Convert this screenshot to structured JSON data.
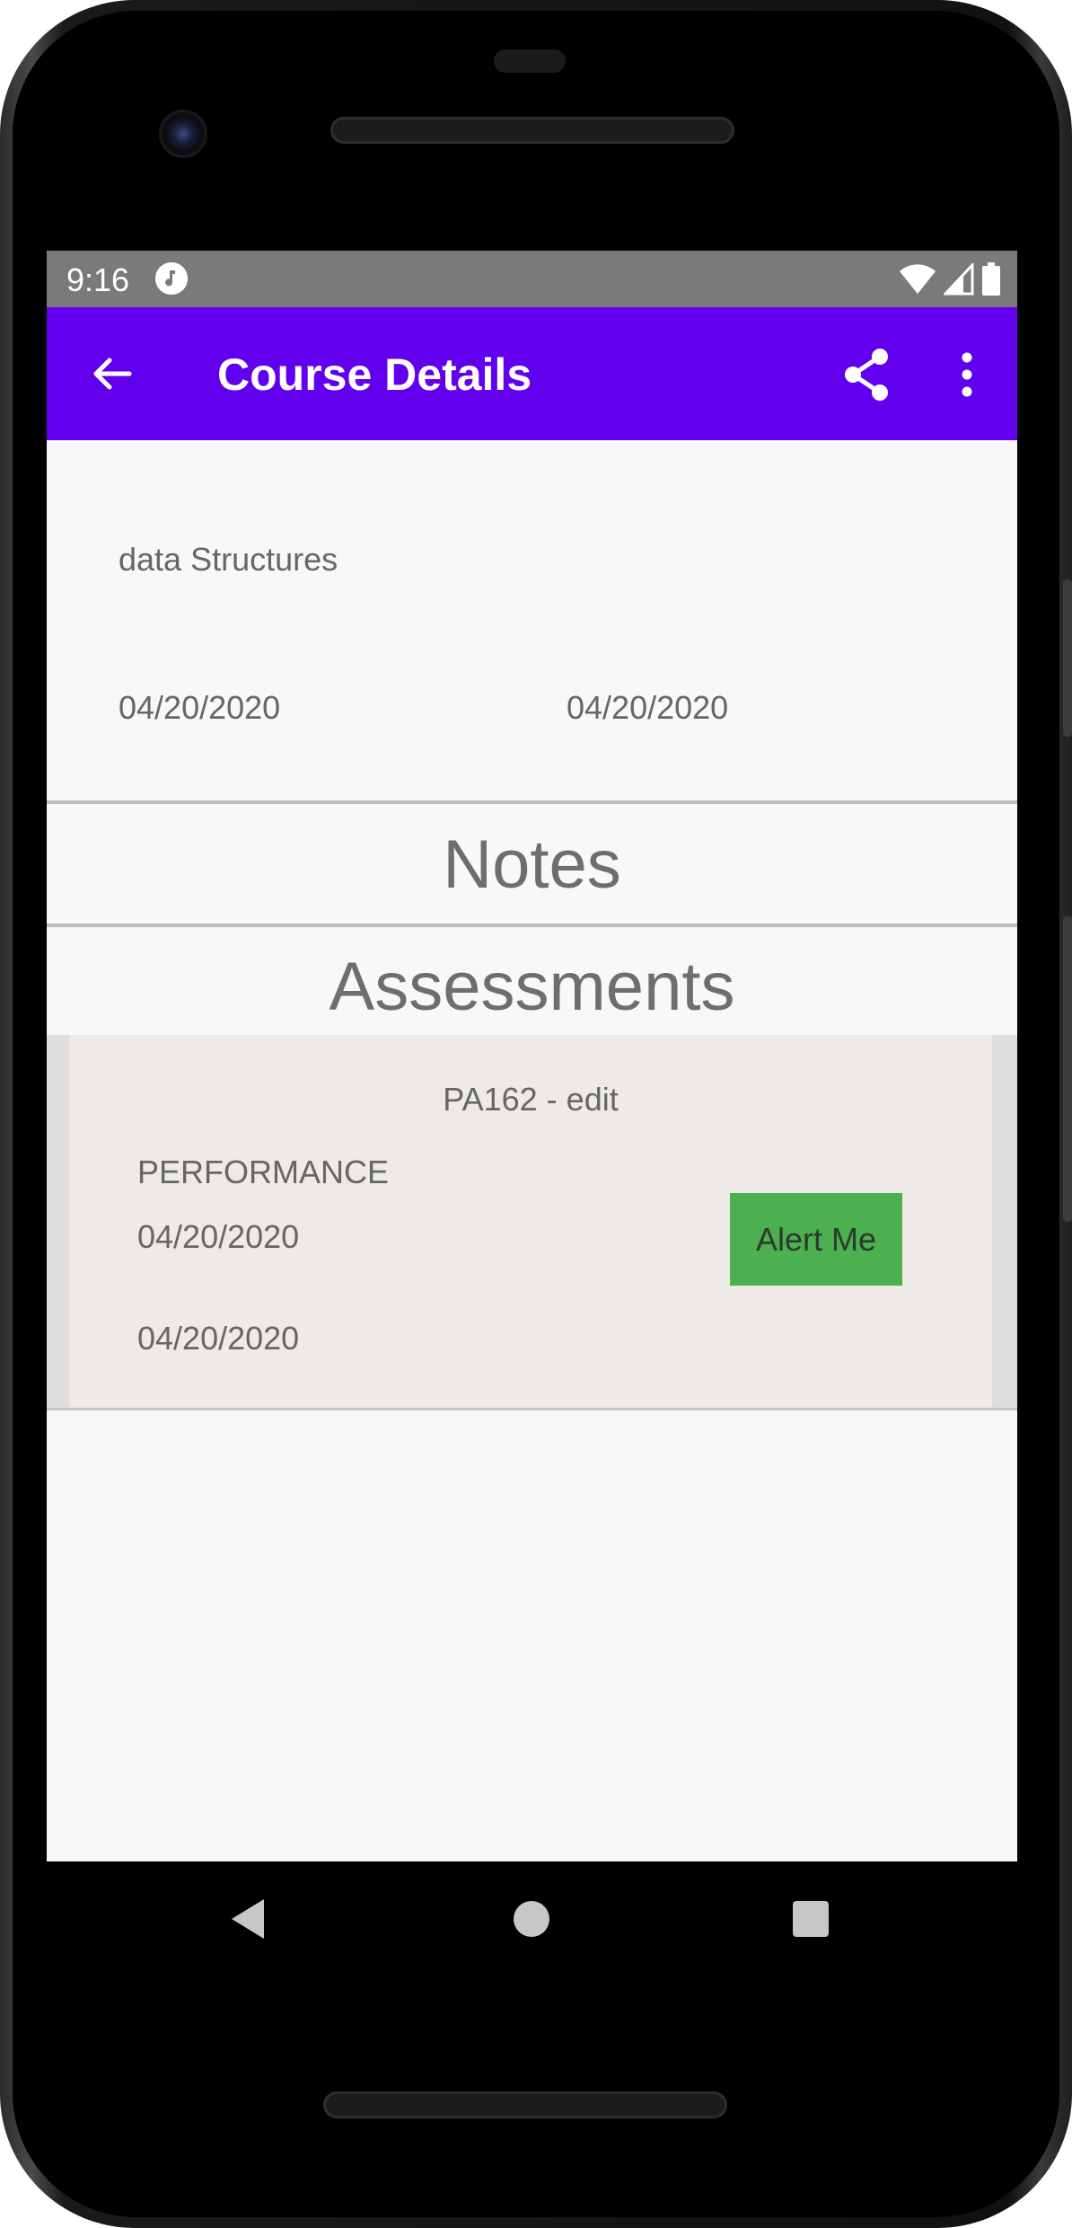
{
  "status_bar": {
    "time": "9:16",
    "icons": [
      "music-note-icon",
      "wifi-icon",
      "cell-signal-icon",
      "battery-icon"
    ]
  },
  "app_bar": {
    "title": "Course Details",
    "color": "#6200ee",
    "icons": [
      "back-arrow-icon",
      "share-icon",
      "more-vert-icon"
    ]
  },
  "course": {
    "name": "data Structures",
    "start_date": "04/20/2020",
    "end_date": "04/20/2020"
  },
  "sections": {
    "notes": "Notes",
    "assessments": "Assessments"
  },
  "assessments": [
    {
      "title": "PA162 - edit",
      "type": "PERFORMANCE",
      "start_date": "04/20/2020",
      "end_date": "04/20/2020",
      "alert_label": "Alert Me",
      "alert_color": "#4caf50"
    }
  ],
  "nav_bar": {
    "icons": [
      "nav-back-icon",
      "nav-home-icon",
      "nav-recents-icon"
    ]
  }
}
